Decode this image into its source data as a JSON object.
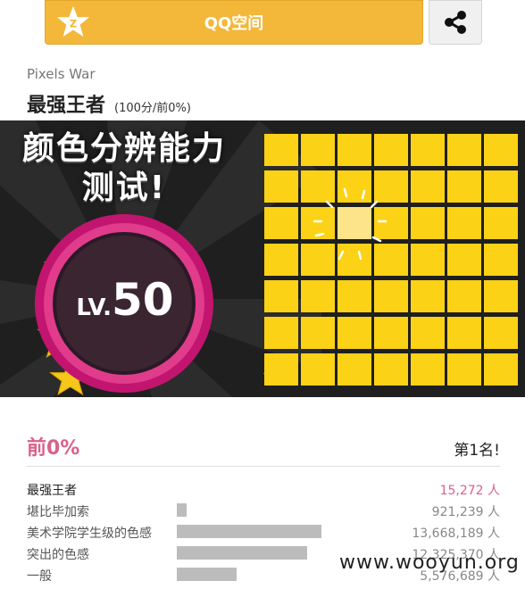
{
  "share_bar": {
    "qq_label": "QQ空间",
    "qq_icon": "qzone-star-icon",
    "share_icon": "share-icon",
    "accent": "#f3b73a"
  },
  "game": {
    "name": "Pixels War",
    "rank_title": "最强王者",
    "score_info": "(100分/前0%)"
  },
  "banner": {
    "headline_1": "颜色分辨能力",
    "headline_2": "测试!",
    "level_prefix": "LV.",
    "level_value": "50",
    "grid_color": "#fcd217",
    "odd_cell_color": "#fde38a"
  },
  "results": {
    "percent": "前0%",
    "rank": "第1名!",
    "rows": [
      {
        "label": "最强王者",
        "count": "15,272 人",
        "fraction": 0.0
      },
      {
        "label": "堪比毕加索",
        "count": "921,239 人",
        "fraction": 0.044
      },
      {
        "label": "美术学院学生级的色感",
        "count": "13,668,189 人",
        "fraction": 0.675
      },
      {
        "label": "突出的色感",
        "count": "12,325,370 人",
        "fraction": 0.61
      },
      {
        "label": "一般",
        "count": "5,576,689 人",
        "fraction": 0.28
      }
    ]
  },
  "watermark": "www.wooyun.org"
}
